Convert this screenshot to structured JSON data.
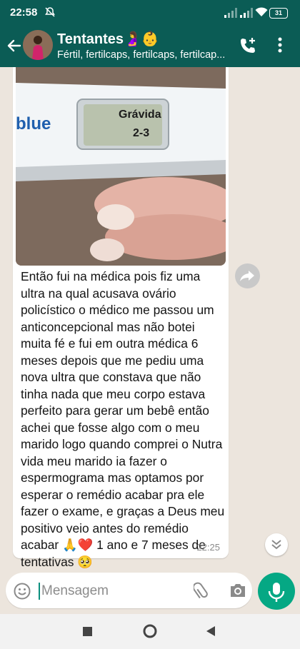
{
  "status_bar": {
    "time": "22:58",
    "battery": "31"
  },
  "header": {
    "title": "Tentantes🤰👶",
    "subtitle": "Fértil, fertilcaps, fertilcaps, fertilcap..."
  },
  "message": {
    "image": {
      "brand": "blue",
      "screen_result": "Grávida",
      "weeks": "2-3"
    },
    "text": "Então fui na médica pois fiz uma ultra na qual acusava ovário policístico o médico me passou um anticoncepcional mas não botei muita fé e fui em outra médica 6 meses depois que me pediu uma nova ultra que constava que não tinha nada que meu corpo estava perfeito para gerar um bebê então achei que fosse algo com o meu marido logo quando comprei o Nutra vida meu marido ia fazer o espermograma mas optamos por esperar o remédio acabar pra ele fazer o exame, e graças a Deus meu positivo veio antes do remédio acabar 🙏❤️ 1 ano e 7 meses de tentativas 🥺",
    "time": "22:25"
  },
  "composer": {
    "placeholder": "Mensagem"
  },
  "colors": {
    "header": "#0b5c55",
    "chat_background": "#ece5dd",
    "accent": "#05a884"
  }
}
